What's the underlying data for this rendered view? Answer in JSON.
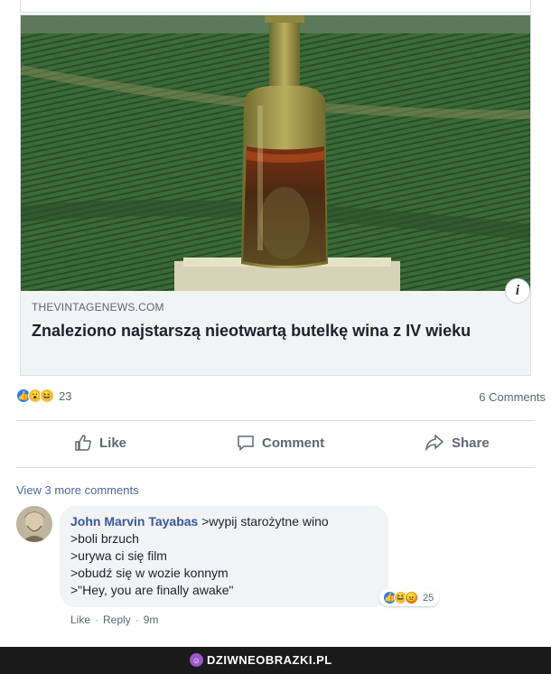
{
  "post": {
    "link": {
      "domain": "THEVINTAGENEWS.COM",
      "title": "Znaleziono najstarszą nieotwartą butelkę wina z IV wieku",
      "info_icon": "i"
    },
    "reactions": {
      "count": "23",
      "types": [
        "like-icon",
        "wow-icon",
        "haha-icon"
      ]
    },
    "comments_count": "6 Comments",
    "actions": {
      "like": "Like",
      "comment": "Comment",
      "share": "Share"
    }
  },
  "comments": {
    "view_more": "View 3 more comments",
    "items": [
      {
        "author": "John Marvin Tayabas",
        "lines": [
          ">wypij starożytne wino",
          ">boli brzuch",
          ">urywa ci się film",
          ">obudź się w wozie konnym",
          ">\"Hey, you are finally awake\""
        ],
        "reaction_count": "25",
        "actions": {
          "like": "Like",
          "reply": "Reply",
          "time": "9m",
          "sep": "·"
        }
      }
    ]
  },
  "footer": {
    "brand": "DZIWNEOBRAZKI.PL"
  },
  "colors": {
    "link_blue": "#385898",
    "like_blue": "#2e7df6",
    "footer_bg": "#1a1a1a"
  }
}
